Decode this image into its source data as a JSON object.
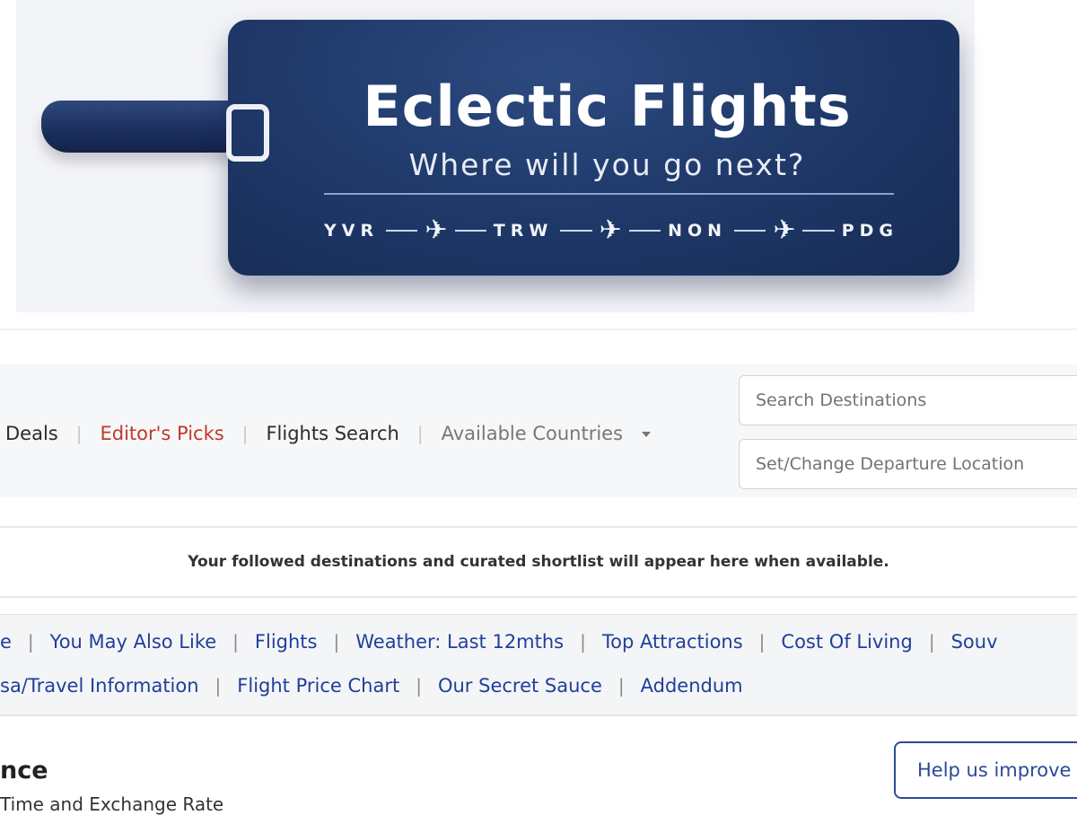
{
  "banner": {
    "title": "Eclectic Flights",
    "subtitle": "Where will you go next?",
    "route": [
      "YVR",
      "TRW",
      "NON",
      "PDG"
    ]
  },
  "nav": {
    "links": [
      {
        "label": "Deals"
      },
      {
        "label": "Editor's Picks"
      },
      {
        "label": "Flights Search"
      },
      {
        "label": "Available Countries"
      }
    ],
    "search_placeholder": "Search Destinations",
    "departure_placeholder": "Set/Change Departure Location"
  },
  "info_text": "Your followed destinations and curated shortlist will appear here when available.",
  "section_nav": {
    "row1": [
      "e",
      "You May Also Like",
      "Flights",
      "Weather: Last 12mths",
      "Top Attractions",
      "Cost Of Living",
      "Souv"
    ],
    "row2": [
      "sa/Travel Information",
      "Flight Price Chart",
      "Our Secret Sauce",
      "Addendum"
    ]
  },
  "content": {
    "heading": "nce",
    "subline": "Time and Exchange Rate"
  },
  "help_button_label": "Help us improve",
  "colors": {
    "tag_navy": "#203a6b",
    "editor_red": "#c0392b",
    "link_blue": "#1f3f9a"
  }
}
